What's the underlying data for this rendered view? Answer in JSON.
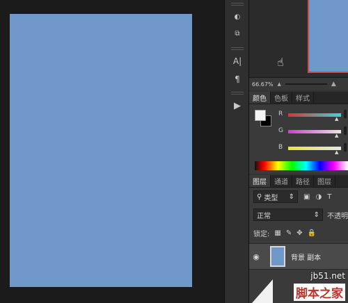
{
  "colors": {
    "canvas": "#6f98c8",
    "workspace": "#1b1b1b",
    "accent_red": "#c94a4a"
  },
  "tools": [
    {
      "name": "quick-mask-icon",
      "glyph": "◐"
    },
    {
      "name": "screen-mode-icon",
      "glyph": "⧉"
    },
    {
      "name": "character-panel-icon",
      "glyph": "A|"
    },
    {
      "name": "paragraph-panel-icon",
      "glyph": "¶"
    },
    {
      "name": "play-actions-icon",
      "glyph": "▶"
    }
  ],
  "navigator": {
    "zoom": "66.67%"
  },
  "color_panel": {
    "tabs": [
      "颜色",
      "色板",
      "样式"
    ],
    "active_tab": "颜色",
    "sliders": [
      {
        "label": "R",
        "gradient": "linear-gradient(to right, #d53535, #3ad6d6)"
      },
      {
        "label": "G",
        "gradient": "linear-gradient(to right, #d13cd1, #e6e6e6)"
      },
      {
        "label": "B",
        "gradient": "linear-gradient(to right, #e6e63a, #e6e6e6)"
      }
    ]
  },
  "layers_panel": {
    "tabs": [
      "图层",
      "通道",
      "路径",
      "图层"
    ],
    "active_tab": "图层",
    "filter_label": "类型",
    "blend_mode": "正常",
    "opacity_label": "不透明",
    "lock_label": "锁定:",
    "layer_name": "背景 副本"
  },
  "watermark": {
    "url": "jb51.net",
    "name": "脚本之家"
  }
}
